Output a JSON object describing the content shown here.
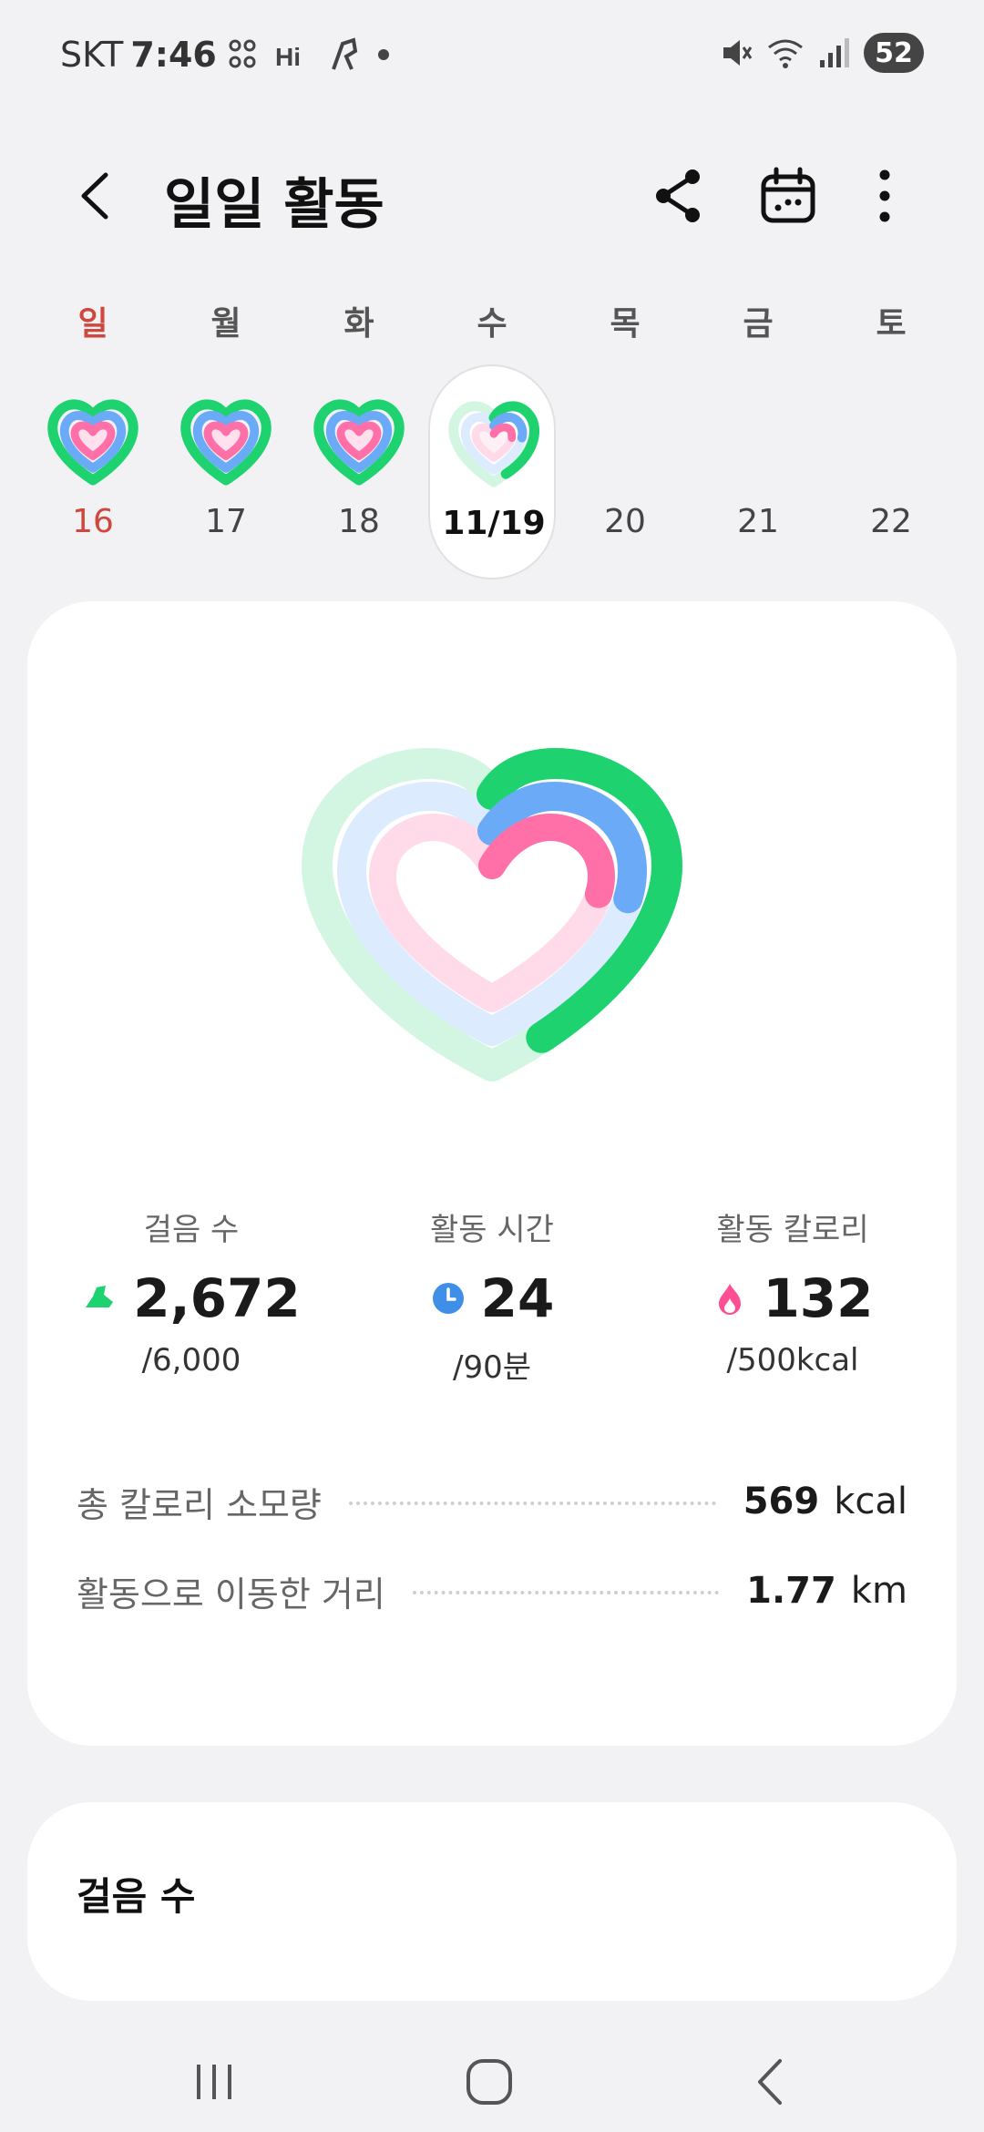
{
  "status_bar": {
    "carrier": "SKT",
    "time": "7:46",
    "left_icons": [
      "game-icon",
      "hi-icon",
      "walking-icon",
      "dot-icon"
    ],
    "right_icons": [
      "mute-icon",
      "wifi-icon",
      "signal-icon"
    ],
    "battery": "52"
  },
  "header": {
    "title": "일일 활동",
    "actions": [
      "share-icon",
      "calendar-icon",
      "more-icon"
    ]
  },
  "week": {
    "days": [
      "일",
      "월",
      "화",
      "수",
      "목",
      "금",
      "토"
    ],
    "dates": [
      "16",
      "17",
      "18",
      "11/19",
      "20",
      "21",
      "22"
    ],
    "selected_index": 3
  },
  "summary": {
    "steps": {
      "label": "걸음 수",
      "value": "2,672",
      "goal": "/6,000",
      "progress": 0.445
    },
    "active_time": {
      "label": "활동 시간",
      "value": "24",
      "goal": "/90분",
      "progress": 0.267
    },
    "active_calories": {
      "label": "활동 칼로리",
      "value": "132",
      "goal": "/500kcal",
      "progress": 0.264
    }
  },
  "stats": [
    {
      "label": "총 칼로리 소모량",
      "value": "569",
      "unit": "kcal"
    },
    {
      "label": "활동으로 이동한 거리",
      "value": "1.77",
      "unit": "km"
    }
  ],
  "steps_card": {
    "title": "걸음 수"
  },
  "colors": {
    "steps": "#1ed36f",
    "active_time": "#6aaaf7",
    "calories": "#ff6fa8",
    "sunday": "#d0473d"
  }
}
